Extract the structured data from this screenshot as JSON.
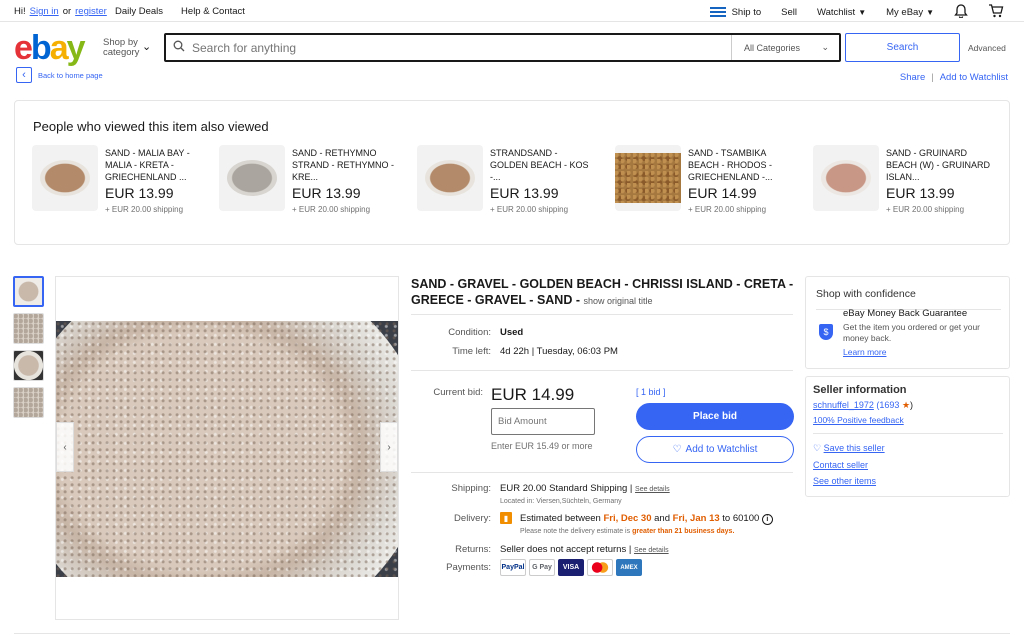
{
  "topbar": {
    "greeting": "Hi!",
    "sign_in": "Sign in",
    "or": "or",
    "register": "register",
    "daily_deals": "Daily Deals",
    "help_contact": "Help & Contact",
    "ship_to": "Ship to",
    "sell": "Sell",
    "watchlist": "Watchlist",
    "my_ebay": "My eBay"
  },
  "header": {
    "logo": {
      "e": "e",
      "b": "b",
      "a": "a",
      "y": "y"
    },
    "shop_by_1": "Shop by",
    "shop_by_2": "category",
    "search_placeholder": "Search for anything",
    "category": "All Categories",
    "search_button": "Search",
    "advanced": "Advanced",
    "back_home": "Back to home page",
    "share": "Share",
    "separator": "|",
    "add_watchlist": "Add to Watchlist"
  },
  "also_viewed": {
    "heading": "People who viewed this item also viewed",
    "items": [
      {
        "title": "SAND - MALIA BAY - MALIA - KRETA - GRIECHENLAND ...",
        "price": "EUR 13.99",
        "shipping": "+ EUR 20.00 shipping"
      },
      {
        "title": "SAND - RETHYMNO STRAND - RETHYMNO - KRE...",
        "price": "EUR 13.99",
        "shipping": "+ EUR 20.00 shipping"
      },
      {
        "title": "STRANDSAND - GOLDEN BEACH - KOS -...",
        "price": "EUR 13.99",
        "shipping": "+ EUR 20.00 shipping"
      },
      {
        "title": "SAND - TSAMBIKA BEACH - RHODOS - GRIECHENLAND -...",
        "price": "EUR 14.99",
        "shipping": "+ EUR 20.00 shipping"
      },
      {
        "title": "SAND - GRUINARD BEACH (W) - GRUINARD ISLAN...",
        "price": "EUR 13.99",
        "shipping": "+ EUR 20.00 shipping"
      }
    ]
  },
  "listing": {
    "title": "SAND - GRAVEL - GOLDEN BEACH - CHRISSI ISLAND - CRETA - GREECE - GRAVEL - SAND -",
    "show_original": "show original title",
    "condition_label": "Condition:",
    "condition": "Used",
    "time_left_label": "Time left:",
    "time_left": "4d 22h | Tuesday, 06:03 PM",
    "current_bid_label": "Current bid:",
    "current_bid": "EUR 14.99",
    "bids": "[ 1 bid ]",
    "bid_placeholder": "Bid Amount",
    "enter_hint": "Enter EUR 15.49 or more",
    "place_bid": "Place bid",
    "add_watchlist": "Add to Watchlist",
    "shipping_label": "Shipping:",
    "shipping": "EUR 20.00 Standard Shipping |",
    "see_details": "See details",
    "location": "Located in: Viersen,Süchteln, Germany",
    "delivery_label": "Delivery:",
    "delivery_pre": "Estimated between",
    "delivery_from": "Fri, Dec 30",
    "delivery_and": "and",
    "delivery_to": "Fri, Jan 13",
    "delivery_post": "to 60100",
    "delivery_note_pre": "Please note the delivery estimate is",
    "delivery_note_strong": "greater than 21 business days.",
    "returns_label": "Returns:",
    "returns": "Seller does not accept returns |",
    "payments_label": "Payments:",
    "payments": [
      "PayPal",
      "G Pay",
      "VISA",
      "MC",
      "AMEX"
    ]
  },
  "confidence": {
    "heading": "Shop with confidence",
    "guarantee_title": "eBay Money Back Guarantee",
    "guarantee_text": "Get the item you ordered or get your money back.",
    "learn_more": "Learn more"
  },
  "seller": {
    "heading": "Seller information",
    "name": "schnuffel_1972",
    "feedback": "(1693",
    "feedback_end": ")",
    "positive": "100% Positive feedback",
    "save": "Save this seller",
    "contact": "Contact seller",
    "other_items": "See other items"
  },
  "colors": {
    "accent": "#3665f3",
    "orange": "#e05d00"
  }
}
